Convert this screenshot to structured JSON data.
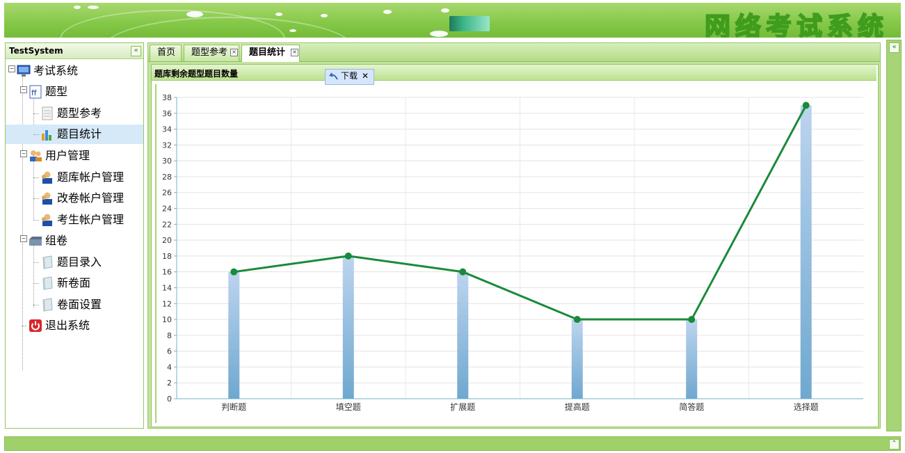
{
  "header": {
    "title": "网络考试系统"
  },
  "nav": {
    "title": "TestSystem",
    "collapse_icon": "«",
    "tree": [
      {
        "label": "考试系统",
        "icon": "monitor-icon"
      },
      {
        "label": "题型",
        "icon": "type-book-icon"
      },
      {
        "label": "题型参考",
        "icon": "document-icon"
      },
      {
        "label": "题目统计",
        "icon": "bar-chart-icon",
        "selected": true
      },
      {
        "label": "用户管理",
        "icon": "users-icon"
      },
      {
        "label": "题库帐户管理",
        "icon": "user-icon"
      },
      {
        "label": "改卷帐户管理",
        "icon": "user-icon"
      },
      {
        "label": "考生帐户管理",
        "icon": "user-icon"
      },
      {
        "label": "组卷",
        "icon": "folder-icon"
      },
      {
        "label": "题目录入",
        "icon": "paper-icon"
      },
      {
        "label": "新卷面",
        "icon": "paper-icon"
      },
      {
        "label": "卷面设置",
        "icon": "paper-icon"
      },
      {
        "label": "退出系统",
        "icon": "power-icon"
      }
    ]
  },
  "tabs": [
    {
      "label": "首页",
      "closable": false
    },
    {
      "label": "题型参考",
      "closable": true
    },
    {
      "label": "题目统计",
      "closable": true,
      "active": true
    }
  ],
  "content": {
    "title": "题库剩余题型题目数量",
    "download": {
      "label": "下载",
      "close": "✕"
    }
  },
  "right_strip": {
    "collapse_icon": "«"
  },
  "bottom_bar": {
    "expand_icon": "⌃"
  },
  "colors": {
    "accent": "#86c94a",
    "line": "#1a8a3a",
    "bar": "#8db8dc"
  },
  "chart_data": {
    "type": "bar",
    "categories": [
      "判断题",
      "填空题",
      "扩展题",
      "提高题",
      "简答题",
      "选择题"
    ],
    "series": [
      {
        "type": "bar",
        "values": [
          16,
          18,
          16,
          10,
          10,
          37
        ]
      },
      {
        "type": "line",
        "values": [
          16,
          18,
          16,
          10,
          10,
          37
        ]
      }
    ],
    "ylim": [
      0,
      38
    ],
    "yticks": [
      0,
      2,
      4,
      6,
      8,
      10,
      12,
      14,
      16,
      18,
      20,
      22,
      24,
      26,
      28,
      30,
      32,
      34,
      36,
      38
    ],
    "grid": true,
    "title": "",
    "xlabel": "",
    "ylabel": ""
  }
}
